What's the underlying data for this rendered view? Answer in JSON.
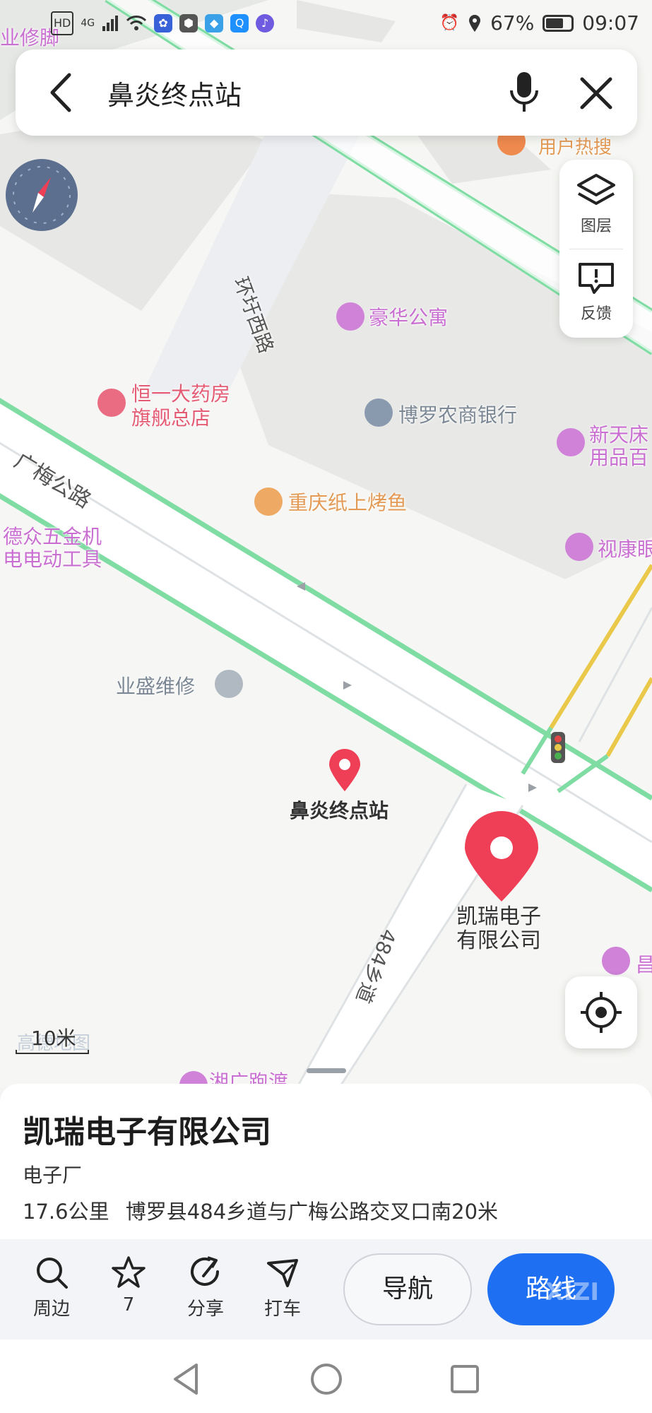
{
  "status_bar": {
    "left_icons": [
      "HD",
      "4G",
      "signal-icon",
      "wifi-icon",
      "baidu-icon",
      "shield-icon",
      "app-icon",
      "search-app-icon",
      "music-icon"
    ],
    "alarm_icon": "alarm-icon",
    "location_icon": "location-icon",
    "battery_percent": "67%",
    "time": "09:07"
  },
  "search": {
    "query": "鼻炎终点站",
    "back_icon": "back-icon",
    "mic_icon": "mic-icon",
    "close_icon": "close-icon"
  },
  "map": {
    "tools": [
      {
        "label": "图层",
        "icon": "layers-icon"
      },
      {
        "label": "反馈",
        "icon": "feedback-icon"
      }
    ],
    "road_labels": [
      "广梅公路",
      "环圩西路",
      "484乡道"
    ],
    "poi_labels": [
      {
        "text": "豪华公寓",
        "style": "pink"
      },
      {
        "text": "恒一大药房",
        "style": "red"
      },
      {
        "text": "旗舰总店",
        "style": "red"
      },
      {
        "text": "博罗农商银行",
        "style": "grey"
      },
      {
        "text": "新天床",
        "style": "pink"
      },
      {
        "text": "用品百",
        "style": "pink"
      },
      {
        "text": "重庆纸上烤鱼",
        "style": "orange"
      },
      {
        "text": "德众五金机",
        "style": "pink"
      },
      {
        "text": "电电动工具",
        "style": "pink"
      },
      {
        "text": "视康眼",
        "style": "pink"
      },
      {
        "text": "业盛维修",
        "style": "grey"
      },
      {
        "text": "用户热搜",
        "style": "orange"
      },
      {
        "text": "业修脚",
        "style": "pink"
      },
      {
        "text": "昌",
        "style": "pink"
      },
      {
        "text": "湘广跑渡",
        "style": "pink"
      }
    ],
    "markers": [
      {
        "text": "鼻炎终点站",
        "style": "small-red"
      },
      {
        "text": "凯瑞电子",
        "text2": "有限公司",
        "style": "big-red"
      }
    ],
    "scale_label": "10米",
    "watermark": "高德地图",
    "locate_icon": "locate-icon",
    "compass_icon": "compass-icon"
  },
  "place": {
    "title": "凯瑞电子有限公司",
    "category": "电子厂",
    "distance": "17.6公里",
    "address": "博罗县484乡道与广梅公路交叉口南20米"
  },
  "actions": [
    {
      "label": "周边",
      "icon": "search-icon"
    },
    {
      "label": "7",
      "icon": "star-icon"
    },
    {
      "label": "分享",
      "icon": "share-icon"
    },
    {
      "label": "打车",
      "icon": "taxi-icon"
    }
  ],
  "buttons": {
    "navigate": "导航",
    "route": "路线",
    "route_watermark": "XIZI"
  },
  "colors": {
    "accent": "#1f6ff2",
    "marker": "#ee3f56",
    "road_green": "#7fdca3",
    "road_yellow": "#e9c84a"
  }
}
